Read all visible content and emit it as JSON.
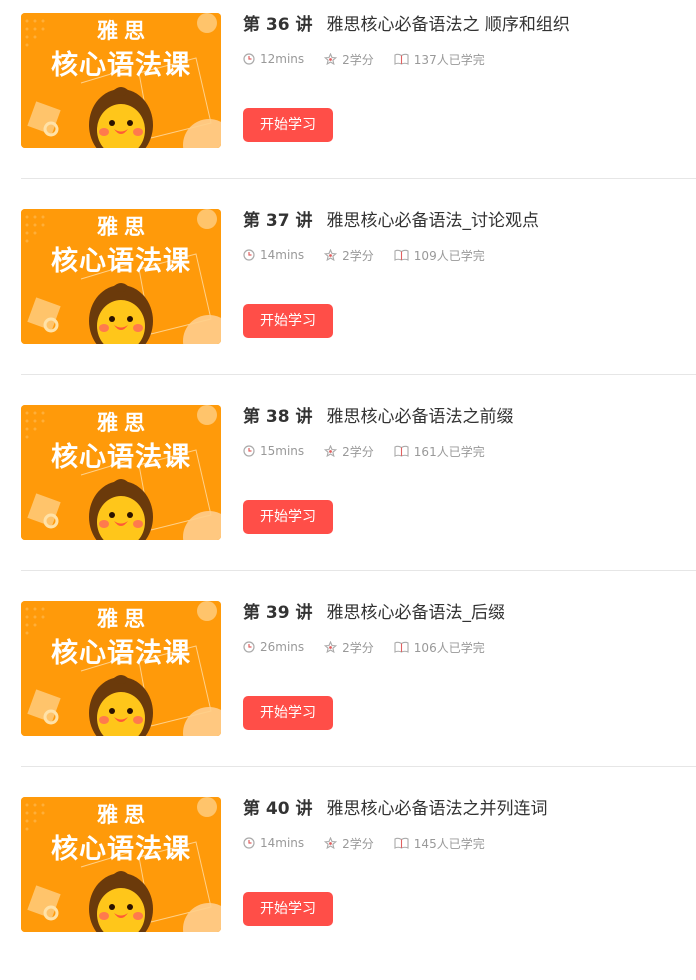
{
  "thumbnail": {
    "line1": "雅思",
    "line2": "核心语法课"
  },
  "start_label": "开始学习",
  "lessons": [
    {
      "number": "第 36 讲",
      "title": "雅思核心必备语法之 顺序和组织",
      "duration": "12mins",
      "credits": "2学分",
      "completed": "137人已学完"
    },
    {
      "number": "第 37 讲",
      "title": "雅思核心必备语法_讨论观点",
      "duration": "14mins",
      "credits": "2学分",
      "completed": "109人已学完"
    },
    {
      "number": "第 38 讲",
      "title": "雅思核心必备语法之前缀",
      "duration": "15mins",
      "credits": "2学分",
      "completed": "161人已学完"
    },
    {
      "number": "第 39 讲",
      "title": "雅思核心必备语法_后缀",
      "duration": "26mins",
      "credits": "2学分",
      "completed": "106人已学完"
    },
    {
      "number": "第 40 讲",
      "title": "雅思核心必备语法之并列连词",
      "duration": "14mins",
      "credits": "2学分",
      "completed": "145人已学完"
    }
  ],
  "colors": {
    "thumbnail_bg": "#ff9a0a",
    "button_bg": "#ff4e48",
    "meta_text": "#999999"
  },
  "icons": {
    "duration": "clock-icon",
    "credits": "star-icon",
    "completed": "book-icon"
  }
}
